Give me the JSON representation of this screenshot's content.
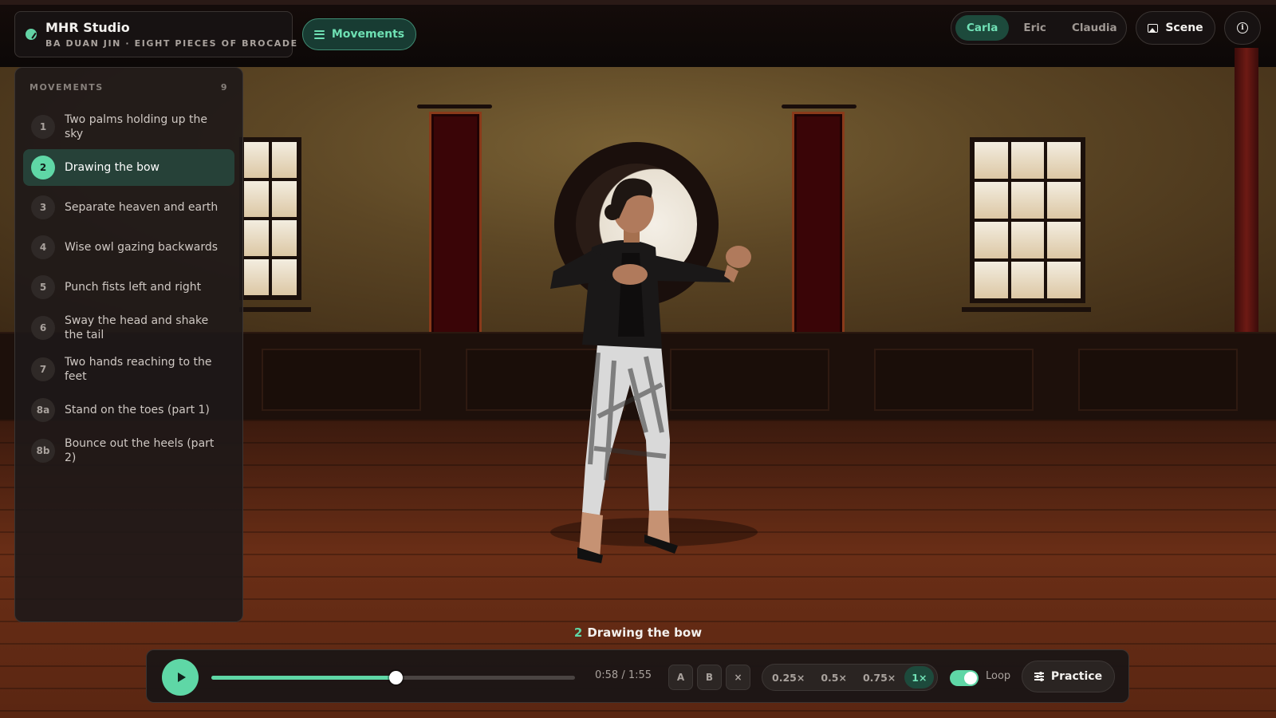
{
  "app": {
    "title": "MHR Studio",
    "subtitle": "BA DUAN JIN · EIGHT PIECES OF BROCADE"
  },
  "toolbar": {
    "movements_label": "Movements",
    "scene_label": "Scene",
    "characters": [
      {
        "label": "Carla",
        "active": true
      },
      {
        "label": "Eric",
        "active": false
      },
      {
        "label": "Claudia",
        "active": false
      }
    ]
  },
  "sidebar": {
    "heading": "MOVEMENTS",
    "count": "9",
    "items": [
      {
        "num": "1",
        "label": "Two palms holding up the sky"
      },
      {
        "num": "2",
        "label": "Drawing the bow",
        "active": true
      },
      {
        "num": "3",
        "label": "Separate heaven and earth"
      },
      {
        "num": "4",
        "label": "Wise owl gazing backwards"
      },
      {
        "num": "5",
        "label": "Punch fists left and right"
      },
      {
        "num": "6",
        "label": "Sway the head and shake the tail"
      },
      {
        "num": "7",
        "label": "Two hands reaching to the feet"
      },
      {
        "num": "8a",
        "label": "Stand on the toes (part 1)"
      },
      {
        "num": "8b",
        "label": "Bounce out the heels (part 2)"
      }
    ]
  },
  "caption": {
    "num": "2",
    "label": "Drawing the bow"
  },
  "player": {
    "time": "0:58 / 1:55",
    "progress": 0.506,
    "a_label": "A",
    "b_label": "B",
    "clear_label": "×",
    "speeds": [
      {
        "label": "0.25×",
        "active": false
      },
      {
        "label": "0.5×",
        "active": false
      },
      {
        "label": "0.75×",
        "active": false
      },
      {
        "label": "1×",
        "active": true
      }
    ],
    "loop_label": "Loop",
    "loop_on": true,
    "practice_label": "Practice"
  },
  "colors": {
    "accent": "#5fd7a6",
    "panel": "#1e1818",
    "active_bg": "#1d4a3c"
  },
  "icons": [
    "brand-logo-icon",
    "hamburger-icon",
    "image-icon",
    "info-icon",
    "play-icon",
    "sliders-icon"
  ]
}
